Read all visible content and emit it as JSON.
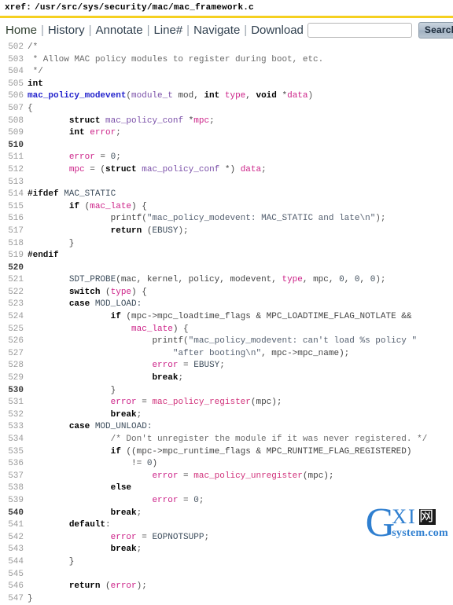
{
  "header": {
    "xref_label": "xref:",
    "path": "/usr/src/sys/security/mac/mac_framework.c"
  },
  "menubar": {
    "links": [
      {
        "label": "Home",
        "name": "nav-home"
      },
      {
        "label": "History",
        "name": "nav-history"
      },
      {
        "label": "Annotate",
        "name": "nav-annotate"
      },
      {
        "label": "Line#",
        "name": "nav-linenumber"
      },
      {
        "label": "Navigate",
        "name": "nav-navigate"
      },
      {
        "label": "Download",
        "name": "nav-download"
      }
    ],
    "separator": "|",
    "search_value": "",
    "search_placeholder": "",
    "search_button": "Search"
  },
  "colors": {
    "rule": "#f5d020",
    "link": "#30404f",
    "definition": "#2222cc",
    "variable": "#cc2288",
    "type": "#7a4fa8",
    "comment": "#6a6a6a",
    "watermark": "#2f7fd0"
  },
  "code": {
    "first_line": 502,
    "lines": [
      {
        "n": 502,
        "tokens": [
          {
            "t": "/*",
            "c": "c-comment"
          }
        ]
      },
      {
        "n": 503,
        "tokens": [
          {
            "t": " * Allow MAC policy modules to register during boot, etc.",
            "c": "c-comment"
          }
        ]
      },
      {
        "n": 504,
        "tokens": [
          {
            "t": " */",
            "c": "c-comment"
          }
        ]
      },
      {
        "n": 505,
        "tokens": [
          {
            "t": "int",
            "c": "c-kw"
          }
        ]
      },
      {
        "n": 506,
        "tokens": [
          {
            "t": "mac_policy_modevent",
            "c": "c-def"
          },
          {
            "t": "(",
            "c": "c-punct"
          },
          {
            "t": "module_t",
            "c": "c-type"
          },
          {
            "t": " mod, ",
            "c": "c-plain"
          },
          {
            "t": "int",
            "c": "c-kw"
          },
          {
            "t": " ",
            "c": "c-plain"
          },
          {
            "t": "type",
            "c": "c-var"
          },
          {
            "t": ", ",
            "c": "c-plain"
          },
          {
            "t": "void",
            "c": "c-kw"
          },
          {
            "t": " *",
            "c": "c-plain"
          },
          {
            "t": "data",
            "c": "c-var"
          },
          {
            "t": ")",
            "c": "c-punct"
          }
        ]
      },
      {
        "n": 507,
        "tokens": [
          {
            "t": "{",
            "c": "c-punct"
          }
        ]
      },
      {
        "n": 508,
        "tokens": [
          {
            "t": "        ",
            "c": "c-plain"
          },
          {
            "t": "struct",
            "c": "c-kw"
          },
          {
            "t": " ",
            "c": "c-plain"
          },
          {
            "t": "mac_policy_conf",
            "c": "c-type"
          },
          {
            "t": " *",
            "c": "c-plain"
          },
          {
            "t": "mpc",
            "c": "c-var"
          },
          {
            "t": ";",
            "c": "c-punct"
          }
        ]
      },
      {
        "n": 509,
        "tokens": [
          {
            "t": "        ",
            "c": "c-plain"
          },
          {
            "t": "int",
            "c": "c-kw"
          },
          {
            "t": " ",
            "c": "c-plain"
          },
          {
            "t": "error",
            "c": "c-var"
          },
          {
            "t": ";",
            "c": "c-punct"
          }
        ]
      },
      {
        "n": 510,
        "tokens": []
      },
      {
        "n": 511,
        "tokens": [
          {
            "t": "        ",
            "c": "c-plain"
          },
          {
            "t": "error",
            "c": "c-var"
          },
          {
            "t": " = ",
            "c": "c-plain"
          },
          {
            "t": "0",
            "c": "c-num"
          },
          {
            "t": ";",
            "c": "c-punct"
          }
        ]
      },
      {
        "n": 512,
        "tokens": [
          {
            "t": "        ",
            "c": "c-plain"
          },
          {
            "t": "mpc",
            "c": "c-var"
          },
          {
            "t": " = (",
            "c": "c-plain"
          },
          {
            "t": "struct",
            "c": "c-kw"
          },
          {
            "t": " ",
            "c": "c-plain"
          },
          {
            "t": "mac_policy_conf",
            "c": "c-type"
          },
          {
            "t": " *) ",
            "c": "c-plain"
          },
          {
            "t": "data",
            "c": "c-var"
          },
          {
            "t": ";",
            "c": "c-punct"
          }
        ]
      },
      {
        "n": 513,
        "tokens": []
      },
      {
        "n": 514,
        "tokens": [
          {
            "t": "#ifdef",
            "c": "c-pp"
          },
          {
            "t": " MAC_STATIC",
            "c": "c-macro"
          }
        ]
      },
      {
        "n": 515,
        "tokens": [
          {
            "t": "        ",
            "c": "c-plain"
          },
          {
            "t": "if",
            "c": "c-kw"
          },
          {
            "t": " (",
            "c": "c-plain"
          },
          {
            "t": "mac_late",
            "c": "c-var"
          },
          {
            "t": ") {",
            "c": "c-plain"
          }
        ]
      },
      {
        "n": 516,
        "tokens": [
          {
            "t": "                ",
            "c": "c-plain"
          },
          {
            "t": "printf",
            "c": "c-plain"
          },
          {
            "t": "(",
            "c": "c-punct"
          },
          {
            "t": "\"mac_policy_modevent: MAC_STATIC and late\\n\"",
            "c": "c-str"
          },
          {
            "t": ");",
            "c": "c-punct"
          }
        ]
      },
      {
        "n": 517,
        "tokens": [
          {
            "t": "                ",
            "c": "c-plain"
          },
          {
            "t": "return",
            "c": "c-kw"
          },
          {
            "t": " (",
            "c": "c-plain"
          },
          {
            "t": "EBUSY",
            "c": "c-macro"
          },
          {
            "t": ");",
            "c": "c-punct"
          }
        ]
      },
      {
        "n": 518,
        "tokens": [
          {
            "t": "        }",
            "c": "c-plain"
          }
        ]
      },
      {
        "n": 519,
        "tokens": [
          {
            "t": "#endif",
            "c": "c-pp"
          }
        ]
      },
      {
        "n": 520,
        "tokens": []
      },
      {
        "n": 521,
        "tokens": [
          {
            "t": "        ",
            "c": "c-plain"
          },
          {
            "t": "SDT_PROBE",
            "c": "c-macro"
          },
          {
            "t": "(mac, kernel, policy, modevent, ",
            "c": "c-plain"
          },
          {
            "t": "type",
            "c": "c-var"
          },
          {
            "t": ", mpc, ",
            "c": "c-plain"
          },
          {
            "t": "0",
            "c": "c-num"
          },
          {
            "t": ", ",
            "c": "c-plain"
          },
          {
            "t": "0",
            "c": "c-num"
          },
          {
            "t": ", ",
            "c": "c-plain"
          },
          {
            "t": "0",
            "c": "c-num"
          },
          {
            "t": ");",
            "c": "c-punct"
          }
        ]
      },
      {
        "n": 522,
        "tokens": [
          {
            "t": "        ",
            "c": "c-plain"
          },
          {
            "t": "switch",
            "c": "c-kw"
          },
          {
            "t": " (",
            "c": "c-plain"
          },
          {
            "t": "type",
            "c": "c-var"
          },
          {
            "t": ") {",
            "c": "c-plain"
          }
        ]
      },
      {
        "n": 523,
        "tokens": [
          {
            "t": "        ",
            "c": "c-plain"
          },
          {
            "t": "case",
            "c": "c-kw"
          },
          {
            "t": " MOD_LOAD:",
            "c": "c-macro"
          }
        ]
      },
      {
        "n": 524,
        "tokens": [
          {
            "t": "                ",
            "c": "c-plain"
          },
          {
            "t": "if",
            "c": "c-kw"
          },
          {
            "t": " (mpc->mpc_loadtime_flags & MPC_LOADTIME_FLAG_NOTLATE &&",
            "c": "c-plain"
          }
        ]
      },
      {
        "n": 525,
        "tokens": [
          {
            "t": "                    ",
            "c": "c-plain"
          },
          {
            "t": "mac_late",
            "c": "c-var"
          },
          {
            "t": ") {",
            "c": "c-plain"
          }
        ]
      },
      {
        "n": 526,
        "tokens": [
          {
            "t": "                        ",
            "c": "c-plain"
          },
          {
            "t": "printf",
            "c": "c-plain"
          },
          {
            "t": "(",
            "c": "c-punct"
          },
          {
            "t": "\"mac_policy_modevent: can't load %s policy \"",
            "c": "c-str"
          }
        ]
      },
      {
        "n": 527,
        "tokens": [
          {
            "t": "                            ",
            "c": "c-plain"
          },
          {
            "t": "\"after booting\\n\"",
            "c": "c-str"
          },
          {
            "t": ", mpc->mpc_name);",
            "c": "c-plain"
          }
        ]
      },
      {
        "n": 528,
        "tokens": [
          {
            "t": "                        ",
            "c": "c-plain"
          },
          {
            "t": "error",
            "c": "c-var"
          },
          {
            "t": " = ",
            "c": "c-plain"
          },
          {
            "t": "EBUSY",
            "c": "c-macro"
          },
          {
            "t": ";",
            "c": "c-punct"
          }
        ]
      },
      {
        "n": 529,
        "tokens": [
          {
            "t": "                        ",
            "c": "c-plain"
          },
          {
            "t": "break",
            "c": "c-kw"
          },
          {
            "t": ";",
            "c": "c-punct"
          }
        ]
      },
      {
        "n": 530,
        "tokens": [
          {
            "t": "                }",
            "c": "c-plain"
          }
        ]
      },
      {
        "n": 531,
        "tokens": [
          {
            "t": "                ",
            "c": "c-plain"
          },
          {
            "t": "error",
            "c": "c-var"
          },
          {
            "t": " = ",
            "c": "c-plain"
          },
          {
            "t": "mac_policy_register",
            "c": "c-fn"
          },
          {
            "t": "(mpc);",
            "c": "c-plain"
          }
        ]
      },
      {
        "n": 532,
        "tokens": [
          {
            "t": "                ",
            "c": "c-plain"
          },
          {
            "t": "break",
            "c": "c-kw"
          },
          {
            "t": ";",
            "c": "c-punct"
          }
        ]
      },
      {
        "n": 533,
        "tokens": [
          {
            "t": "        ",
            "c": "c-plain"
          },
          {
            "t": "case",
            "c": "c-kw"
          },
          {
            "t": " MOD_UNLOAD:",
            "c": "c-macro"
          }
        ]
      },
      {
        "n": 534,
        "tokens": [
          {
            "t": "                ",
            "c": "c-plain"
          },
          {
            "t": "/* Don't unregister the module if it was never registered. */",
            "c": "c-comment"
          }
        ]
      },
      {
        "n": 535,
        "tokens": [
          {
            "t": "                ",
            "c": "c-plain"
          },
          {
            "t": "if",
            "c": "c-kw"
          },
          {
            "t": " ((mpc->mpc_runtime_flags & MPC_RUNTIME_FLAG_REGISTERED)",
            "c": "c-plain"
          }
        ]
      },
      {
        "n": 536,
        "tokens": [
          {
            "t": "                    != ",
            "c": "c-plain"
          },
          {
            "t": "0",
            "c": "c-num"
          },
          {
            "t": ")",
            "c": "c-plain"
          }
        ]
      },
      {
        "n": 537,
        "tokens": [
          {
            "t": "                        ",
            "c": "c-plain"
          },
          {
            "t": "error",
            "c": "c-var"
          },
          {
            "t": " = ",
            "c": "c-plain"
          },
          {
            "t": "mac_policy_unregister",
            "c": "c-fn"
          },
          {
            "t": "(mpc);",
            "c": "c-plain"
          }
        ]
      },
      {
        "n": 538,
        "tokens": [
          {
            "t": "                ",
            "c": "c-plain"
          },
          {
            "t": "else",
            "c": "c-kw"
          }
        ]
      },
      {
        "n": 539,
        "tokens": [
          {
            "t": "                        ",
            "c": "c-plain"
          },
          {
            "t": "error",
            "c": "c-var"
          },
          {
            "t": " = ",
            "c": "c-plain"
          },
          {
            "t": "0",
            "c": "c-num"
          },
          {
            "t": ";",
            "c": "c-punct"
          }
        ]
      },
      {
        "n": 540,
        "tokens": [
          {
            "t": "                ",
            "c": "c-plain"
          },
          {
            "t": "break",
            "c": "c-kw"
          },
          {
            "t": ";",
            "c": "c-punct"
          }
        ]
      },
      {
        "n": 541,
        "tokens": [
          {
            "t": "        ",
            "c": "c-plain"
          },
          {
            "t": "default",
            "c": "c-kw"
          },
          {
            "t": ":",
            "c": "c-punct"
          }
        ]
      },
      {
        "n": 542,
        "tokens": [
          {
            "t": "                ",
            "c": "c-plain"
          },
          {
            "t": "error",
            "c": "c-var"
          },
          {
            "t": " = ",
            "c": "c-plain"
          },
          {
            "t": "EOPNOTSUPP",
            "c": "c-macro"
          },
          {
            "t": ";",
            "c": "c-punct"
          }
        ]
      },
      {
        "n": 543,
        "tokens": [
          {
            "t": "                ",
            "c": "c-plain"
          },
          {
            "t": "break",
            "c": "c-kw"
          },
          {
            "t": ";",
            "c": "c-punct"
          }
        ]
      },
      {
        "n": 544,
        "tokens": [
          {
            "t": "        }",
            "c": "c-plain"
          }
        ]
      },
      {
        "n": 545,
        "tokens": []
      },
      {
        "n": 546,
        "tokens": [
          {
            "t": "        ",
            "c": "c-plain"
          },
          {
            "t": "return",
            "c": "c-kw"
          },
          {
            "t": " (",
            "c": "c-plain"
          },
          {
            "t": "error",
            "c": "c-var"
          },
          {
            "t": ");",
            "c": "c-punct"
          }
        ]
      },
      {
        "n": 547,
        "tokens": [
          {
            "t": "}",
            "c": "c-punct"
          }
        ]
      }
    ]
  },
  "watermark": {
    "letter": "G",
    "mid": "XI",
    "cjk": "网",
    "domain": "system.com"
  }
}
